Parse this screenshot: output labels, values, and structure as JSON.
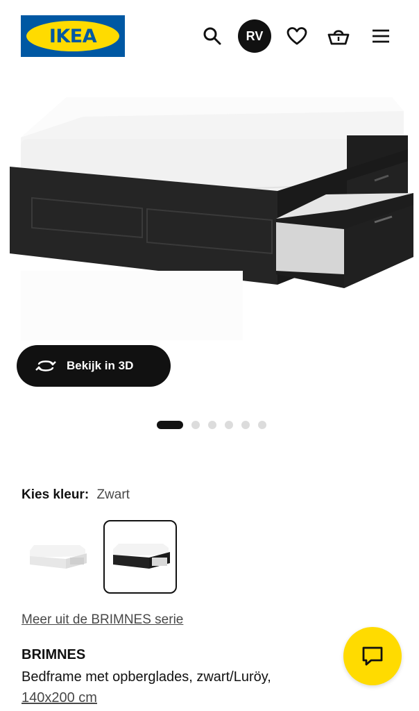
{
  "header": {
    "logo_text": "IKEA",
    "avatar_initials": "RV",
    "icons": [
      "search-icon",
      "heart-icon",
      "basket-icon",
      "menu-icon"
    ]
  },
  "viewer": {
    "view_3d_label": "Bekijk in 3D",
    "carousel_total": 6,
    "carousel_active": 1
  },
  "colour": {
    "label": "Kies kleur:",
    "value": "Zwart",
    "options": [
      "wit",
      "zwart"
    ],
    "selected": "zwart"
  },
  "series_link": "Meer uit de BRIMNES serie",
  "product": {
    "name": "BRIMNES",
    "description": "Bedframe met opberglades, zwart/Luröy,",
    "size": "140x200 cm"
  },
  "colors": {
    "ikea_blue": "#0058a3",
    "ikea_yellow": "#ffdb00",
    "dark": "#111111"
  }
}
